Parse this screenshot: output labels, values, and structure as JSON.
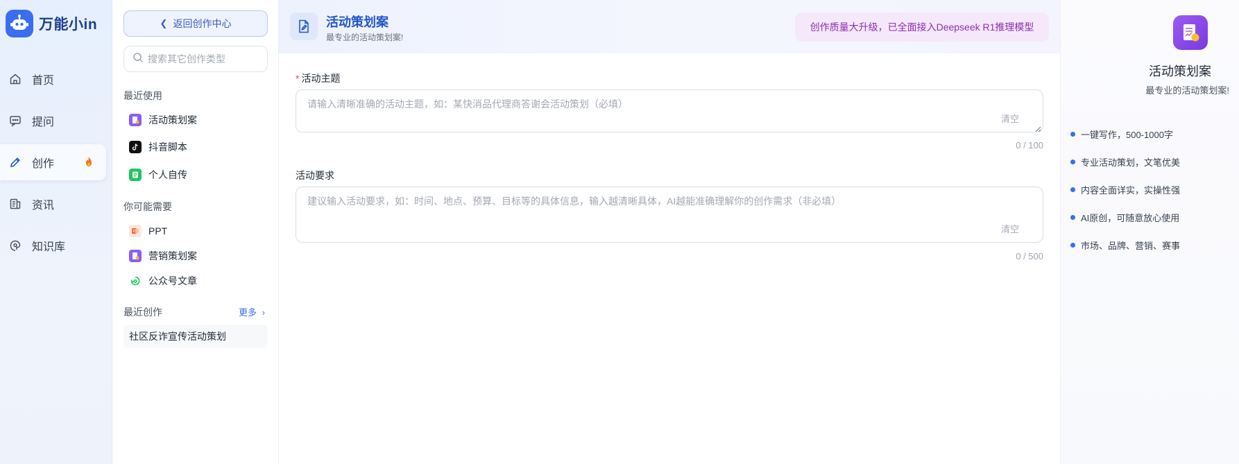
{
  "app": {
    "name": "万能小in"
  },
  "nav": {
    "items": [
      {
        "label": "首页",
        "icon": "home-icon"
      },
      {
        "label": "提问",
        "icon": "chat-icon"
      },
      {
        "label": "创作",
        "icon": "pen-icon",
        "active": true,
        "badge_icon": "fire-icon"
      },
      {
        "label": "资讯",
        "icon": "news-icon"
      },
      {
        "label": "知识库",
        "icon": "brain-icon"
      }
    ]
  },
  "sub": {
    "back_label": "返回创作中心",
    "search_placeholder": "搜索其它创作类型",
    "recent_title": "最近使用",
    "recent": [
      {
        "label": "活动策划案",
        "icon": "plan-doc-icon"
      },
      {
        "label": "抖音脚本",
        "icon": "tiktok-icon"
      },
      {
        "label": "个人自传",
        "icon": "bio-icon"
      }
    ],
    "maybe_title": "你可能需要",
    "maybe": [
      {
        "label": "PPT",
        "icon": "ppt-icon"
      },
      {
        "label": "营销策划案",
        "icon": "marketing-doc-icon"
      },
      {
        "label": "公众号文章",
        "icon": "wechat-article-icon"
      }
    ],
    "creations_title": "最近创作",
    "more_label": "更多",
    "creations": [
      {
        "label": "社区反诈宣传活动策划"
      }
    ]
  },
  "main": {
    "title": "活动策划案",
    "subtitle": "最专业的活动策划案!",
    "banner": "创作质量大升级，已全面接入Deepseek R1推理模型",
    "fields": [
      {
        "label": "活动主题",
        "required": true,
        "placeholder": "请输入清晰准确的活动主题，如：某快消品代理商答谢会活动策划（必填）",
        "value": "",
        "clear_label": "清空",
        "counter": "0 / 100"
      },
      {
        "label": "活动要求",
        "required": false,
        "placeholder": "建议输入活动要求，如：时间、地点、预算、目标等的具体信息，输入越清晰具体，AI越能准确理解你的创作需求（非必填）",
        "value": "",
        "clear_label": "清空",
        "counter": "0 / 500"
      }
    ]
  },
  "right": {
    "title": "活动策划案",
    "subtitle": "最专业的活动策划案!",
    "features": [
      "一键写作，500-1000字",
      "专业活动策划，文笔优美",
      "内容全面详实，实操性强",
      "AI原创，可随意放心使用",
      "市场、品牌、营销、赛事"
    ]
  },
  "colors": {
    "accent": "#3a6df0",
    "title_blue": "#2156c9",
    "banner_bg": "#f5e8fb",
    "banner_text": "#8b2fb0",
    "required": "#e5484d"
  }
}
